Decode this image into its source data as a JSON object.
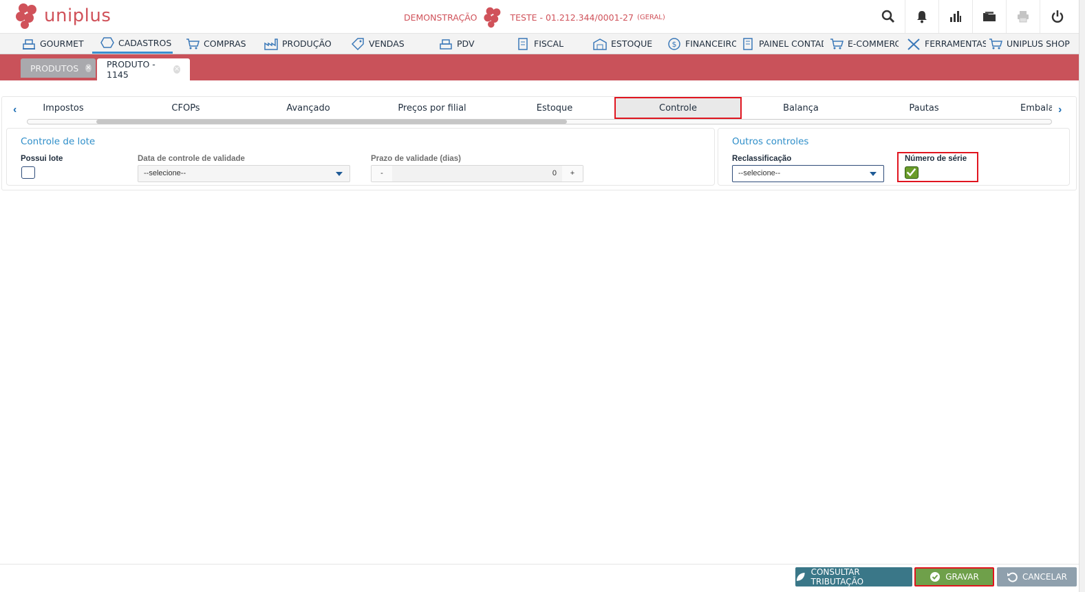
{
  "app": {
    "name": "uniplus"
  },
  "company": {
    "mode": "DEMONSTRAÇÃO",
    "name": "TESTE - 01.212.344/0001-27",
    "scope": "(GERAL)"
  },
  "header_icons": [
    "search-icon",
    "bell-icon",
    "bar-chart-icon",
    "folder-icon",
    "printer-icon",
    "power-icon"
  ],
  "nav": [
    {
      "label": "GOURMET",
      "icon": "cash-register-icon"
    },
    {
      "label": "CADASTROS",
      "icon": "hexagon-icon",
      "active": true
    },
    {
      "label": "COMPRAS",
      "icon": "cart-icon"
    },
    {
      "label": "PRODUÇÃO",
      "icon": "factory-icon"
    },
    {
      "label": "VENDAS",
      "icon": "tag-icon"
    },
    {
      "label": "PDV",
      "icon": "cash-register-icon"
    },
    {
      "label": "FISCAL",
      "icon": "receipt-icon"
    },
    {
      "label": "ESTOQUE",
      "icon": "warehouse-icon"
    },
    {
      "label": "FINANCEIRO",
      "icon": "dollar-icon"
    },
    {
      "label": "PAINEL CONTADOR",
      "icon": "ledger-icon"
    },
    {
      "label": "E-COMMERCE",
      "icon": "cart-icon"
    },
    {
      "label": "FERRAMENTAS",
      "icon": "tools-icon"
    },
    {
      "label": "UNIPLUS SHOP",
      "icon": "cart-icon"
    }
  ],
  "page_tabs": [
    {
      "label": "PRODUTOS",
      "active": false
    },
    {
      "label": "PRODUTO - 1145",
      "active": true
    }
  ],
  "sub_tabs": [
    "Impostos",
    "CFOPs",
    "Avançado",
    "Preços por filial",
    "Estoque",
    "Controle",
    "Balança",
    "Pautas",
    "Embala"
  ],
  "sub_tabs_active": "Controle",
  "panels": {
    "lote": {
      "title": "Controle de lote",
      "possui_lote_label": "Possui lote",
      "possui_lote_checked": false,
      "data_validade_label": "Data de controle de validade",
      "data_validade_value": "--selecione--",
      "prazo_label": "Prazo de validade (dias)",
      "prazo_value": "0",
      "minus": "-",
      "plus": "+"
    },
    "outros": {
      "title": "Outros controles",
      "reclassificacao_label": "Reclassificação",
      "reclassificacao_value": "--selecione--",
      "numero_serie_label": "Número de série",
      "numero_serie_checked": true
    }
  },
  "footer": {
    "consultar": "CONSULTAR TRIBUTAÇÃO",
    "gravar": "GRAVAR",
    "cancelar": "CANCELAR"
  },
  "colors": {
    "brand": "#d0525a",
    "tabstrip": "#c9525a",
    "accent": "#2e8ec9",
    "highlight": "#e0141e"
  }
}
